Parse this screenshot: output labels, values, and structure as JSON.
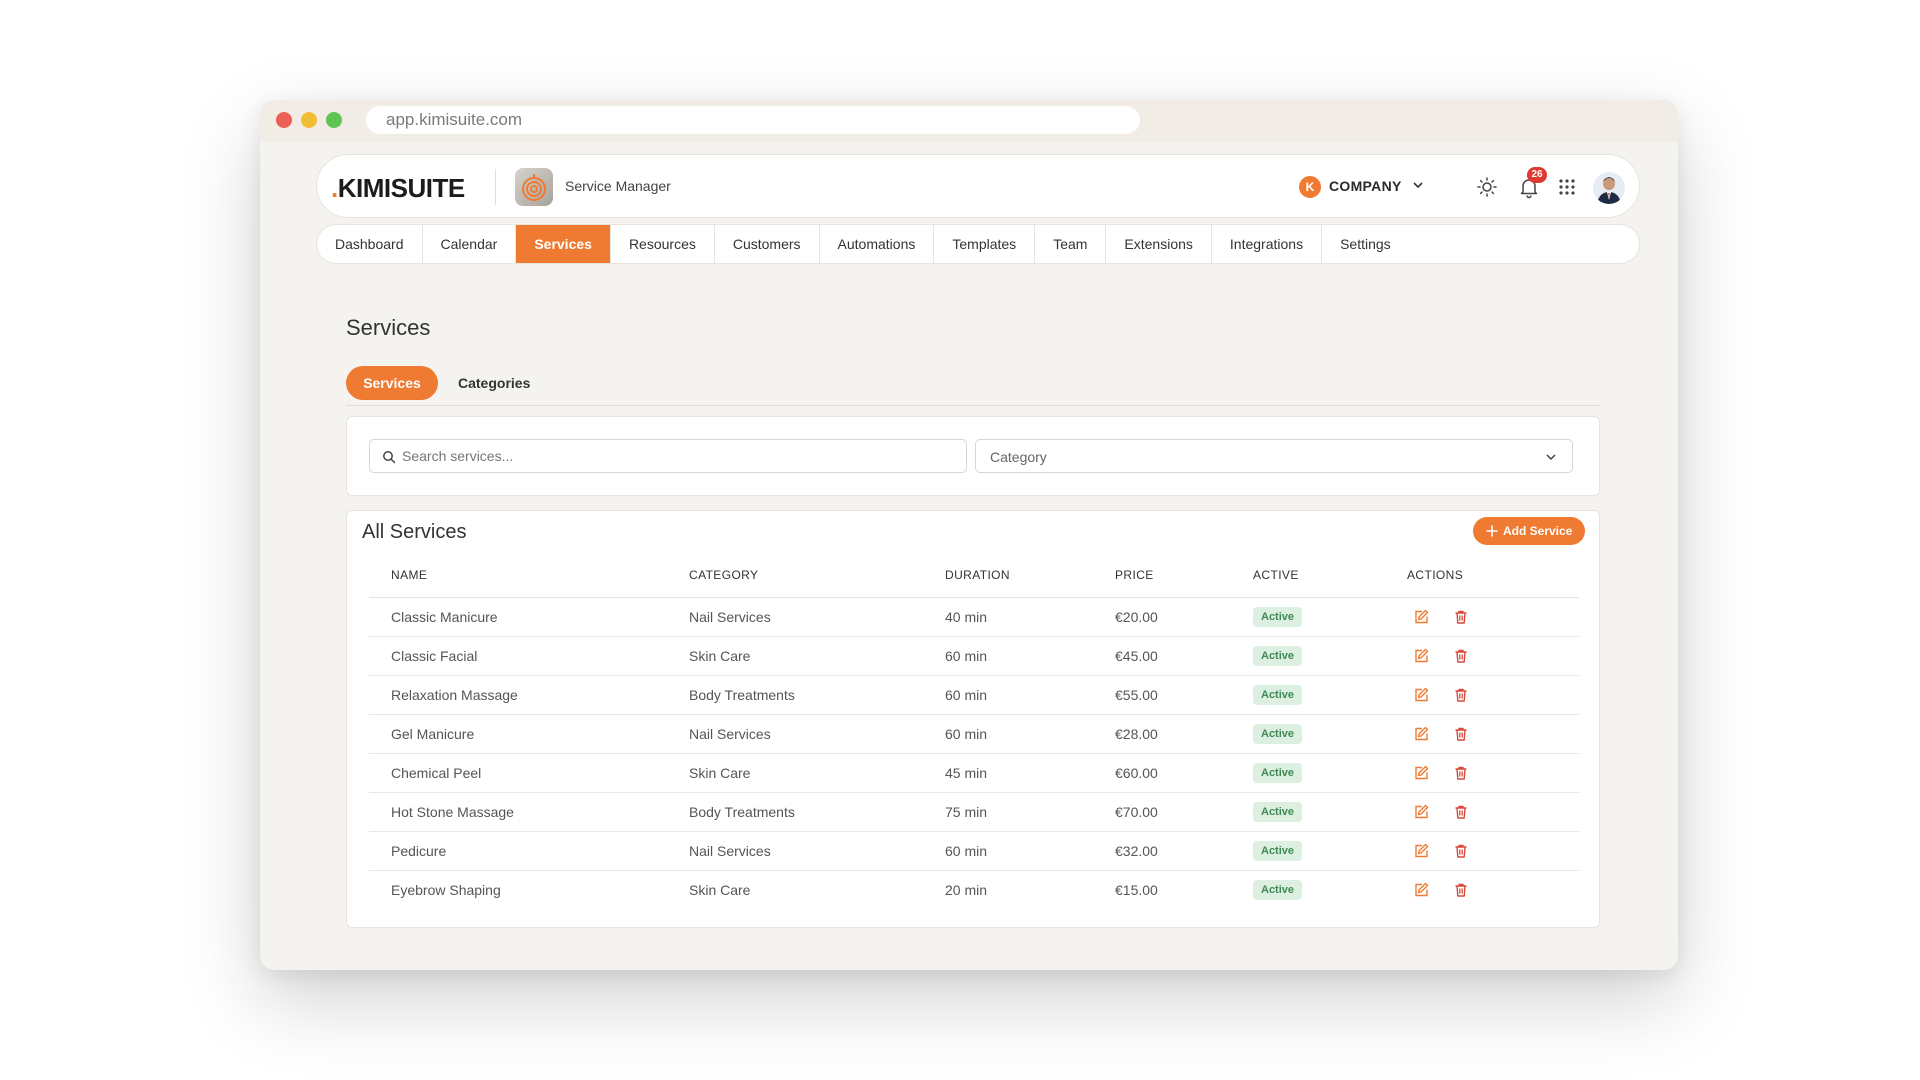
{
  "browser": {
    "url": "app.kimisuite.com"
  },
  "header": {
    "logo_dot": ".",
    "logo_text": "KIMISUITE",
    "app_name": "Service Manager",
    "company_initial": "K",
    "company_name": "COMPANY",
    "notifications_count": "26"
  },
  "nav": {
    "items": [
      "Dashboard",
      "Calendar",
      "Services",
      "Resources",
      "Customers",
      "Automations",
      "Templates",
      "Team",
      "Extensions",
      "Integrations",
      "Settings"
    ],
    "active": "Services"
  },
  "page": {
    "title": "Services",
    "tabs": [
      "Services",
      "Categories"
    ]
  },
  "filters": {
    "search_placeholder": "Search services...",
    "category_label": "Category"
  },
  "table": {
    "title": "All Services",
    "add_label": "Add Service",
    "columns": [
      "NAME",
      "CATEGORY",
      "DURATION",
      "PRICE",
      "ACTIVE",
      "ACTIONS"
    ],
    "rows": [
      {
        "name": "Classic Manicure",
        "category": "Nail Services",
        "duration": "40 min",
        "price": "€20.00",
        "active": "Active"
      },
      {
        "name": "Classic Facial",
        "category": "Skin Care",
        "duration": "60 min",
        "price": "€45.00",
        "active": "Active"
      },
      {
        "name": "Relaxation Massage",
        "category": "Body Treatments",
        "duration": "60 min",
        "price": "€55.00",
        "active": "Active"
      },
      {
        "name": "Gel Manicure",
        "category": "Nail Services",
        "duration": "60 min",
        "price": "€28.00",
        "active": "Active"
      },
      {
        "name": "Chemical Peel",
        "category": "Skin Care",
        "duration": "45 min",
        "price": "€60.00",
        "active": "Active"
      },
      {
        "name": "Hot Stone Massage",
        "category": "Body Treatments",
        "duration": "75 min",
        "price": "€70.00",
        "active": "Active"
      },
      {
        "name": "Pedicure",
        "category": "Nail Services",
        "duration": "60 min",
        "price": "€32.00",
        "active": "Active"
      },
      {
        "name": "Eyebrow Shaping",
        "category": "Skin Care",
        "duration": "20 min",
        "price": "€15.00",
        "active": "Active"
      }
    ]
  },
  "colors": {
    "accent": "#ef7a32",
    "active_badge_bg": "#dcefe0",
    "active_badge_text": "#3e8a55",
    "delete": "#d9483b",
    "badge_red": "#e0392f"
  },
  "icons": {
    "app": "app-logo-icon",
    "chevron": "chevron-down-icon",
    "theme": "sun-icon",
    "notifications": "bell-icon",
    "apps": "grid-icon",
    "search": "search-icon",
    "add": "plus-icon",
    "edit": "edit-icon",
    "delete": "trash-icon"
  }
}
